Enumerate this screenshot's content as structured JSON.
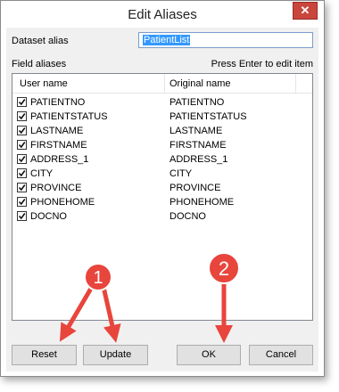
{
  "window": {
    "title": "Edit Aliases",
    "close_glyph": "✕"
  },
  "dataset": {
    "label": "Dataset alias",
    "value": "PatientList"
  },
  "fields": {
    "label": "Field aliases",
    "hint": "Press Enter to edit item"
  },
  "table": {
    "columns": [
      "User name",
      "Original name"
    ],
    "rows": [
      {
        "user": "PATIENTNO",
        "original": "PATIENTNO",
        "checked": true
      },
      {
        "user": "PATIENTSTATUS",
        "original": "PATIENTSTATUS",
        "checked": true
      },
      {
        "user": "LASTNAME",
        "original": "LASTNAME",
        "checked": true
      },
      {
        "user": "FIRSTNAME",
        "original": "FIRSTNAME",
        "checked": true
      },
      {
        "user": "ADDRESS_1",
        "original": "ADDRESS_1",
        "checked": true
      },
      {
        "user": "CITY",
        "original": "CITY",
        "checked": true
      },
      {
        "user": "PROVINCE",
        "original": "PROVINCE",
        "checked": true
      },
      {
        "user": "PHONEHOME",
        "original": "PHONEHOME",
        "checked": true
      },
      {
        "user": "DOCNO",
        "original": "DOCNO",
        "checked": true
      }
    ]
  },
  "buttons": {
    "reset": "Reset",
    "update": "Update",
    "ok": "OK",
    "cancel": "Cancel"
  },
  "annotations": {
    "badge1": "1",
    "badge2": "2",
    "color": "#e8453c"
  }
}
